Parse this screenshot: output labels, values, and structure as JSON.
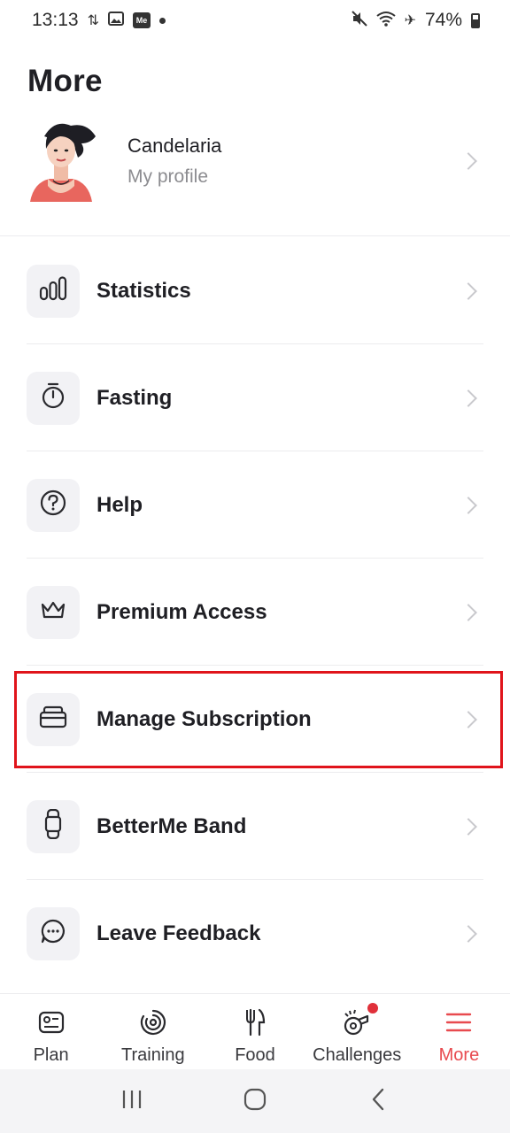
{
  "status_bar": {
    "time": "13:13",
    "battery": "74%",
    "me_badge": "Me"
  },
  "header": {
    "title": "More"
  },
  "profile": {
    "name": "Candelaria",
    "subtitle": "My profile"
  },
  "menu": {
    "items": [
      {
        "label": "Statistics",
        "icon": "bar-chart-icon"
      },
      {
        "label": "Fasting",
        "icon": "stopwatch-icon"
      },
      {
        "label": "Help",
        "icon": "question-icon"
      },
      {
        "label": "Premium Access",
        "icon": "crown-icon"
      },
      {
        "label": "Manage Subscription",
        "icon": "card-stack-icon"
      },
      {
        "label": "BetterMe Band",
        "icon": "fitness-band-icon"
      },
      {
        "label": "Leave Feedback",
        "icon": "chat-bubble-icon"
      }
    ]
  },
  "bottom_nav": {
    "items": [
      {
        "label": "Plan",
        "icon": "plan-card-icon"
      },
      {
        "label": "Training",
        "icon": "training-rings-icon"
      },
      {
        "label": "Food",
        "icon": "fork-knife-icon"
      },
      {
        "label": "Challenges",
        "icon": "whistle-icon"
      },
      {
        "label": "More",
        "icon": "hamburger-menu-icon",
        "active": true
      }
    ]
  },
  "colors": {
    "accent": "#e84a4f",
    "highlight_border": "#e0141b",
    "icon_box_bg": "#f2f2f5",
    "text_primary": "#1f1f24",
    "text_secondary": "#8c8c90"
  }
}
